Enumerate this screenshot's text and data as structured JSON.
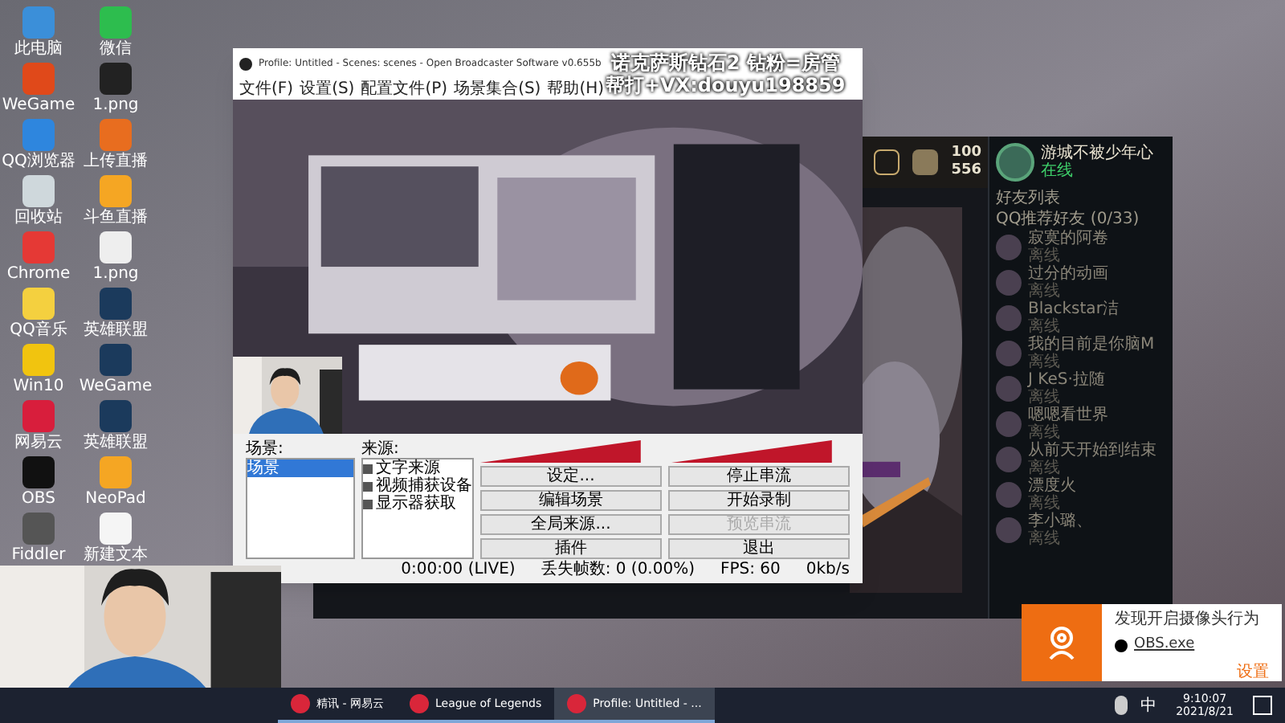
{
  "desktop_icons": [
    {
      "label": "此电脑"
    },
    {
      "label": "微信"
    },
    {
      "label": "WeGame"
    },
    {
      "label": "1.png"
    },
    {
      "label": "QQ浏览器"
    },
    {
      "label": "上传直播"
    },
    {
      "label": "回收站"
    },
    {
      "label": "斗鱼直播"
    },
    {
      "label": "Chrome"
    },
    {
      "label": "1.png"
    },
    {
      "label": "QQ音乐"
    },
    {
      "label": "英雄联盟"
    },
    {
      "label": "Win10"
    },
    {
      "label": "WeGame"
    },
    {
      "label": "网易云"
    },
    {
      "label": "英雄联盟"
    },
    {
      "label": "OBS"
    },
    {
      "label": "NeoPad"
    },
    {
      "label": "Fiddler"
    },
    {
      "label": "新建文本"
    }
  ],
  "obs_window": {
    "title": "Profile: Untitled - Scenes: scenes - Open Broadcaster Software v0.655b",
    "overlay_lines": [
      "诺克萨斯钻石2 钻粉=房管",
      "帮打+VX:douyu198859"
    ],
    "menu": [
      "文件(F)",
      "设置(S)",
      "配置文件(P)",
      "场景集合(S)",
      "帮助(H)"
    ],
    "scenes_label": "场景:",
    "scenes": [
      {
        "label": "场景",
        "selected": true
      }
    ],
    "sources_label": "来源:",
    "sources": [
      {
        "label": "文字来源",
        "checked": true
      },
      {
        "label": "视频捕获设备",
        "checked": true
      },
      {
        "label": "显示器获取",
        "checked": true
      }
    ],
    "buttons": [
      {
        "label": "设定...",
        "disabled": false
      },
      {
        "label": "停止串流",
        "disabled": false
      },
      {
        "label": "编辑场景",
        "disabled": false
      },
      {
        "label": "开始录制",
        "disabled": false
      },
      {
        "label": "全局来源...",
        "disabled": false
      },
      {
        "label": "预览串流",
        "disabled": true
      },
      {
        "label": "插件",
        "disabled": false
      },
      {
        "label": "退出",
        "disabled": false
      }
    ],
    "status": [
      "0:00:00 (LIVE)",
      "丢失帧数: 0 (0.00%)",
      "FPS: 60",
      "0kb/s"
    ]
  },
  "game_client": {
    "currency": [
      "100",
      "556"
    ],
    "username": "游城不被少年心",
    "user_status": "在线",
    "friends_header": "好友列表",
    "group": "QQ推荐好友 (0/33)",
    "friends": [
      {
        "name": "寂寞的阿卷",
        "status": "离线"
      },
      {
        "name": "过分的动画",
        "status": "离线"
      },
      {
        "name": "Blackstar洁",
        "status": "离线"
      },
      {
        "name": "我的目前是你脑M",
        "status": "离线"
      },
      {
        "name": "J KeS·拉随",
        "status": "离线"
      },
      {
        "name": "嗯嗯看世界",
        "status": "离线"
      },
      {
        "name": "从前天开始到结束",
        "status": "离线"
      },
      {
        "name": "漂度火",
        "status": "离线"
      },
      {
        "name": "李小璐、",
        "status": "离线"
      }
    ]
  },
  "notification": {
    "title": "发现开启摄像头行为",
    "app": "OBS.exe",
    "settings": "设置"
  },
  "taskbar": {
    "apps": [
      {
        "label": "精讯 - 网易云",
        "selected": false
      },
      {
        "label": "League of Legends",
        "selected": false
      },
      {
        "label": "Profile: Untitled - ...",
        "selected": true
      }
    ],
    "ime": "中",
    "time": "9:10:07",
    "date": "2021/8/21"
  }
}
